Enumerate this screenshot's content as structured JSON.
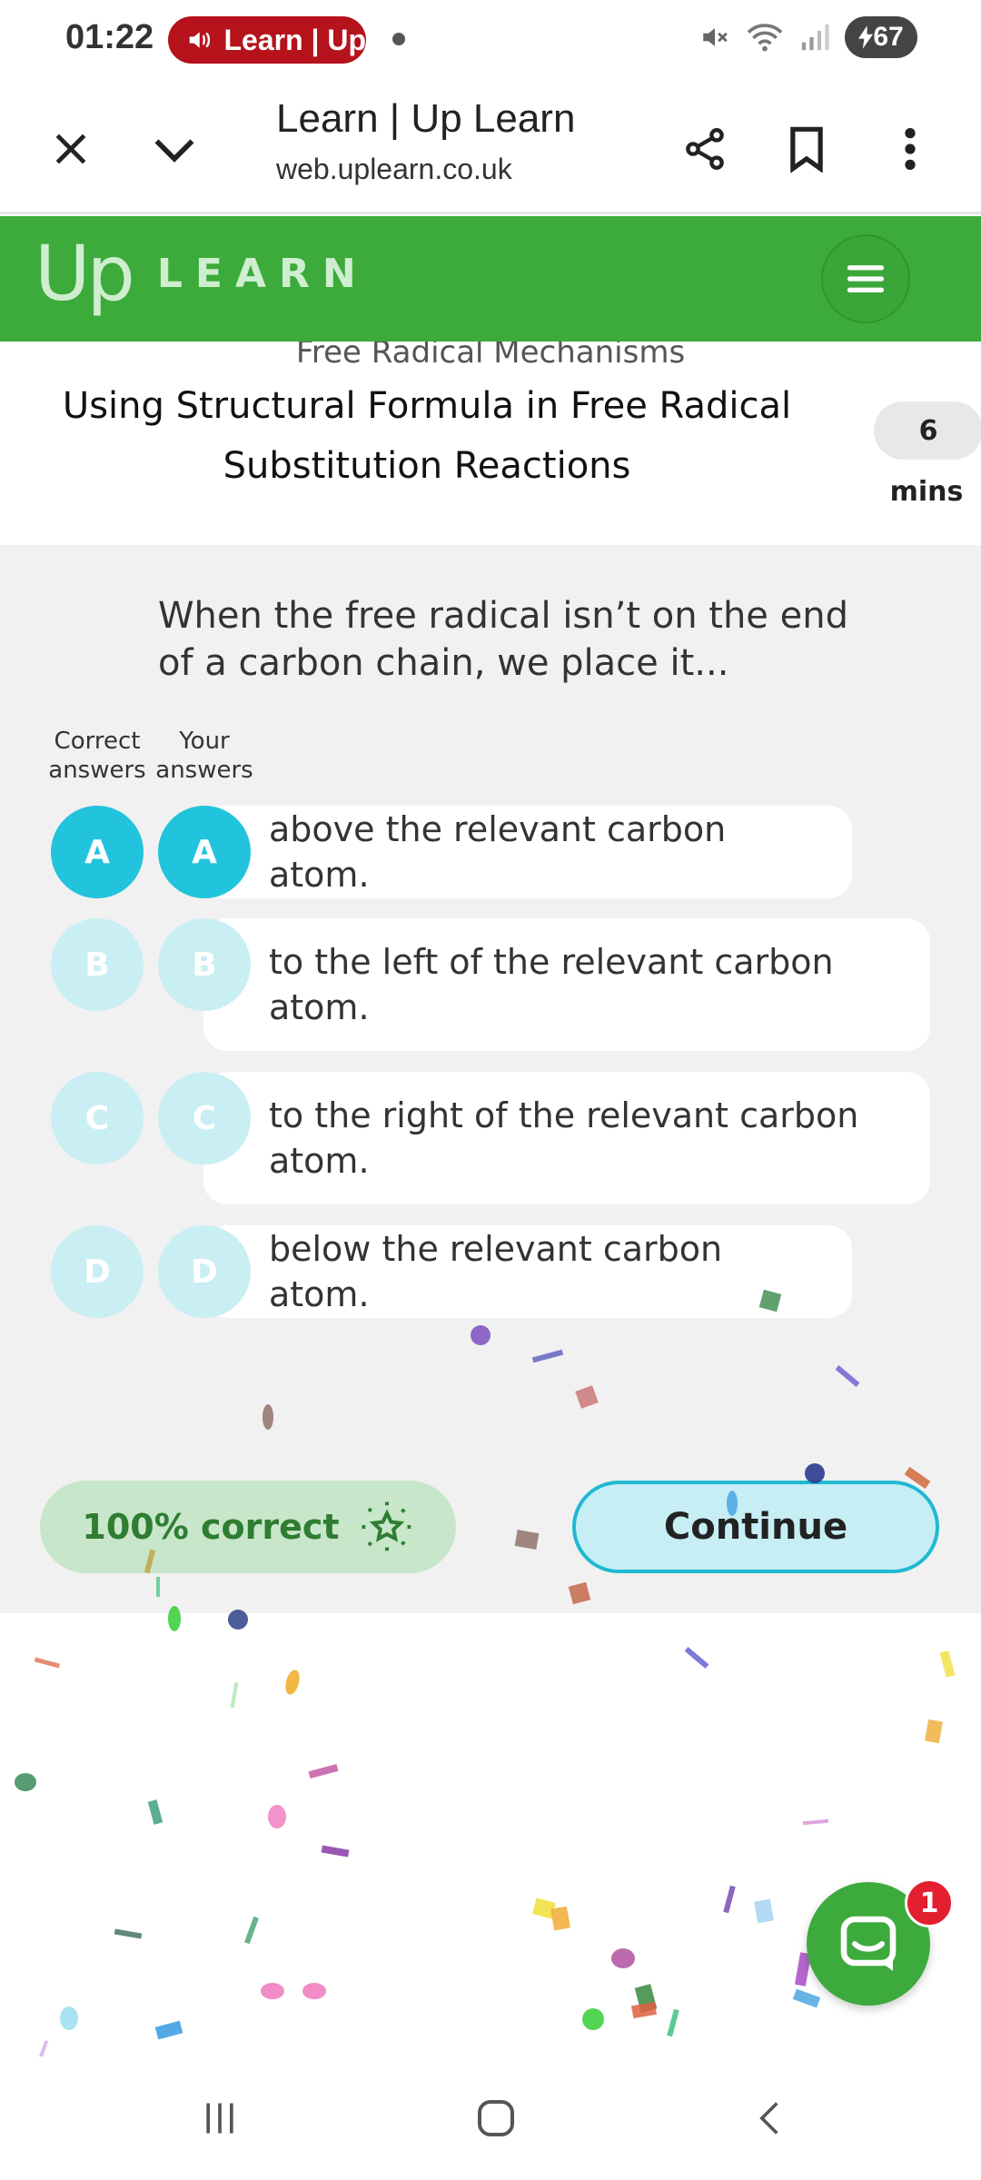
{
  "status_bar": {
    "time": "01:22",
    "notification_pill": "Learn | Up",
    "battery": "67"
  },
  "browser": {
    "page_title": "Learn | Up Learn",
    "url": "web.uplearn.co.uk"
  },
  "site_header": {
    "logo_up": "Up",
    "logo_learn": "LEARN"
  },
  "lesson": {
    "section": "Free Radical Mechanisms",
    "title": "Using Structural Formula in Free Radical Substitution Reactions",
    "duration_value": "6",
    "duration_unit": "mins"
  },
  "question": {
    "text": "When the free radical isn’t on the end of a carbon chain, we place it...",
    "col_correct": "Correct answers",
    "col_yours": "Your answers",
    "options": [
      {
        "letter": "A",
        "text": "above the relevant carbon atom.",
        "selected": true
      },
      {
        "letter": "B",
        "text": "to the left of the relevant carbon atom.",
        "selected": false
      },
      {
        "letter": "C",
        "text": "to the right of the relevant carbon atom.",
        "selected": false
      },
      {
        "letter": "D",
        "text": "below the relevant carbon atom.",
        "selected": false
      }
    ]
  },
  "result": {
    "score_label": "100% correct",
    "continue_label": "Continue"
  },
  "chat": {
    "badge_count": "1"
  },
  "colors": {
    "brand_green": "#3cab3c",
    "accent_cyan": "#22c3dd",
    "faded_cyan": "#c9eef4",
    "success_green": "#2e7d32",
    "badge_red": "#e3202f"
  }
}
